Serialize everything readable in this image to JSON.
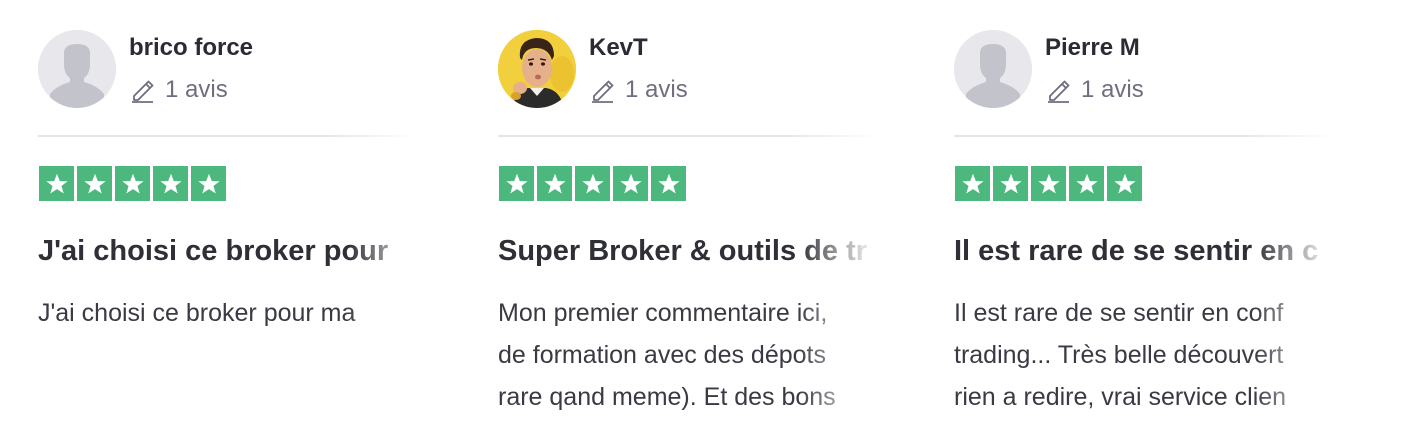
{
  "colors": {
    "star_green": "#4cb87e",
    "avatar_placeholder": "#e8e8ec",
    "muted_text": "#6e6e80"
  },
  "icons": {
    "pencil": "pencil-icon",
    "star": "star-icon",
    "avatar": "person-silhouette-icon"
  },
  "reviews": [
    {
      "name": "brico force",
      "review_count": "1 avis",
      "rating": 5,
      "title": "J'ai choisi ce broker pour",
      "body_lines": [
        "J'ai choisi ce broker pour ma"
      ]
    },
    {
      "name": "KevT",
      "review_count": "1 avis",
      "rating": 5,
      "title": "Super Broker & outils de tr",
      "body_lines": [
        "Mon premier commentaire ici,",
        "de formation avec des dépots",
        "rare qand meme). Et des bons"
      ]
    },
    {
      "name": "Pierre M",
      "review_count": "1 avis",
      "rating": 5,
      "title": "Il est rare de se sentir en c",
      "body_lines": [
        "Il est rare de se sentir en conf",
        "trading... Très belle découvert",
        "rien a redire, vrai service clien"
      ]
    }
  ]
}
